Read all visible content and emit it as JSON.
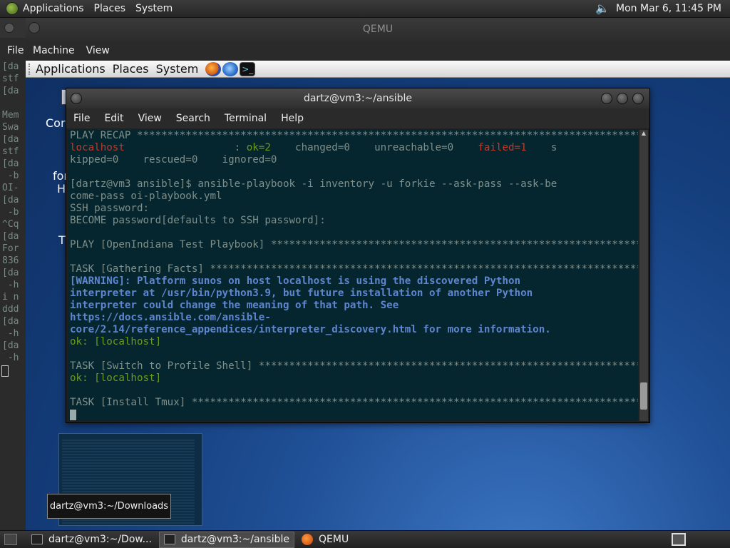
{
  "host_panel": {
    "menus": [
      "Applications",
      "Places",
      "System"
    ],
    "clock": "Mon Mar  6, 11:45 PM"
  },
  "bg_terminal": {
    "menu_label": "File",
    "lines": [
      "[da",
      "stf",
      "[da",
      "",
      "Mem",
      "Swa",
      "[da",
      "stf",
      "[da",
      " -b",
      "OI-",
      "[da",
      " -b",
      "^Cq",
      "[da",
      "For",
      "836",
      "[da",
      " -h",
      "i n",
      "ddd",
      "[da",
      " -h",
      "[da",
      " -h"
    ]
  },
  "qemu": {
    "title": "QEMU",
    "menus": [
      "Machine",
      "View"
    ]
  },
  "guest_panel": {
    "menus": [
      "Applications",
      "Places",
      "System"
    ],
    "launchers": [
      "firefox-icon",
      "thunderbird-icon",
      "terminal-icon"
    ]
  },
  "desktop_fragments": [
    "Cor",
    "for",
    "H",
    "T"
  ],
  "terminal": {
    "title": "dartz@vm3:~/ansible",
    "menus": [
      "File",
      "Edit",
      "View",
      "Search",
      "Terminal",
      "Help"
    ],
    "lines": [
      [
        {
          "t": "PLAY RECAP ******************************************************************************************"
        }
      ],
      [
        {
          "t": "localhost",
          "c": "red"
        },
        {
          "t": "                  : "
        },
        {
          "t": "ok=2",
          "c": "green"
        },
        {
          "t": "    changed=0    unreachable=0    "
        },
        {
          "t": "failed=1",
          "c": "red"
        },
        {
          "t": "    s"
        }
      ],
      [
        {
          "t": "kipped=0    rescued=0    ignored=0"
        }
      ],
      [
        {
          "t": ""
        }
      ],
      [
        {
          "t": "[dartz@vm3 ansible]$ ansible-playbook -i inventory -u forkie --ask-pass --ask-be"
        }
      ],
      [
        {
          "t": "come-pass oi-playbook.yml"
        }
      ],
      [
        {
          "t": "SSH password:"
        }
      ],
      [
        {
          "t": "BECOME password[defaults to SSH password]:"
        }
      ],
      [
        {
          "t": ""
        }
      ],
      [
        {
          "t": "PLAY [OpenIndiana Test Playbook] ********************************************************************"
        }
      ],
      [
        {
          "t": ""
        }
      ],
      [
        {
          "t": "TASK [Gathering Facts] *****************************************************************************"
        }
      ],
      [
        {
          "t": "[WARNING]: Platform sunos on host localhost is using the discovered Python",
          "c": "blue"
        }
      ],
      [
        {
          "t": "interpreter at /usr/bin/python3.9, but future installation of another Python",
          "c": "blue"
        }
      ],
      [
        {
          "t": "interpreter could change the meaning of that path. See",
          "c": "blue"
        }
      ],
      [
        {
          "t": "https://docs.ansible.com/ansible-",
          "c": "blue"
        }
      ],
      [
        {
          "t": "core/2.14/reference_appendices/interpreter_discovery.html for more information.",
          "c": "blue"
        }
      ],
      [
        {
          "t": "ok: [localhost]",
          "c": "green"
        }
      ],
      [
        {
          "t": ""
        }
      ],
      [
        {
          "t": "TASK [Switch to Profile Shell] *********************************************************************"
        }
      ],
      [
        {
          "t": "ok: [localhost]",
          "c": "green"
        }
      ],
      [
        {
          "t": ""
        }
      ],
      [
        {
          "t": "TASK [Install Tmux] ********************************************************************************"
        }
      ]
    ]
  },
  "tooltip": "dartz@vm3:~/Downloads",
  "taskbar": {
    "tasks": [
      {
        "label": "dartz@vm3:~/Dow...",
        "icon": "terminal-icon",
        "active": false
      },
      {
        "label": "dartz@vm3:~/ansible",
        "icon": "terminal-icon",
        "active": true
      },
      {
        "label": "QEMU",
        "icon": "qemu-icon",
        "active": false
      }
    ]
  },
  "colors": {
    "terminal_bg": "#06262f",
    "terminal_fg": "#7f8f8a",
    "red": "#c0392b",
    "green": "#6a9a1e",
    "blue": "#5d86cf"
  }
}
